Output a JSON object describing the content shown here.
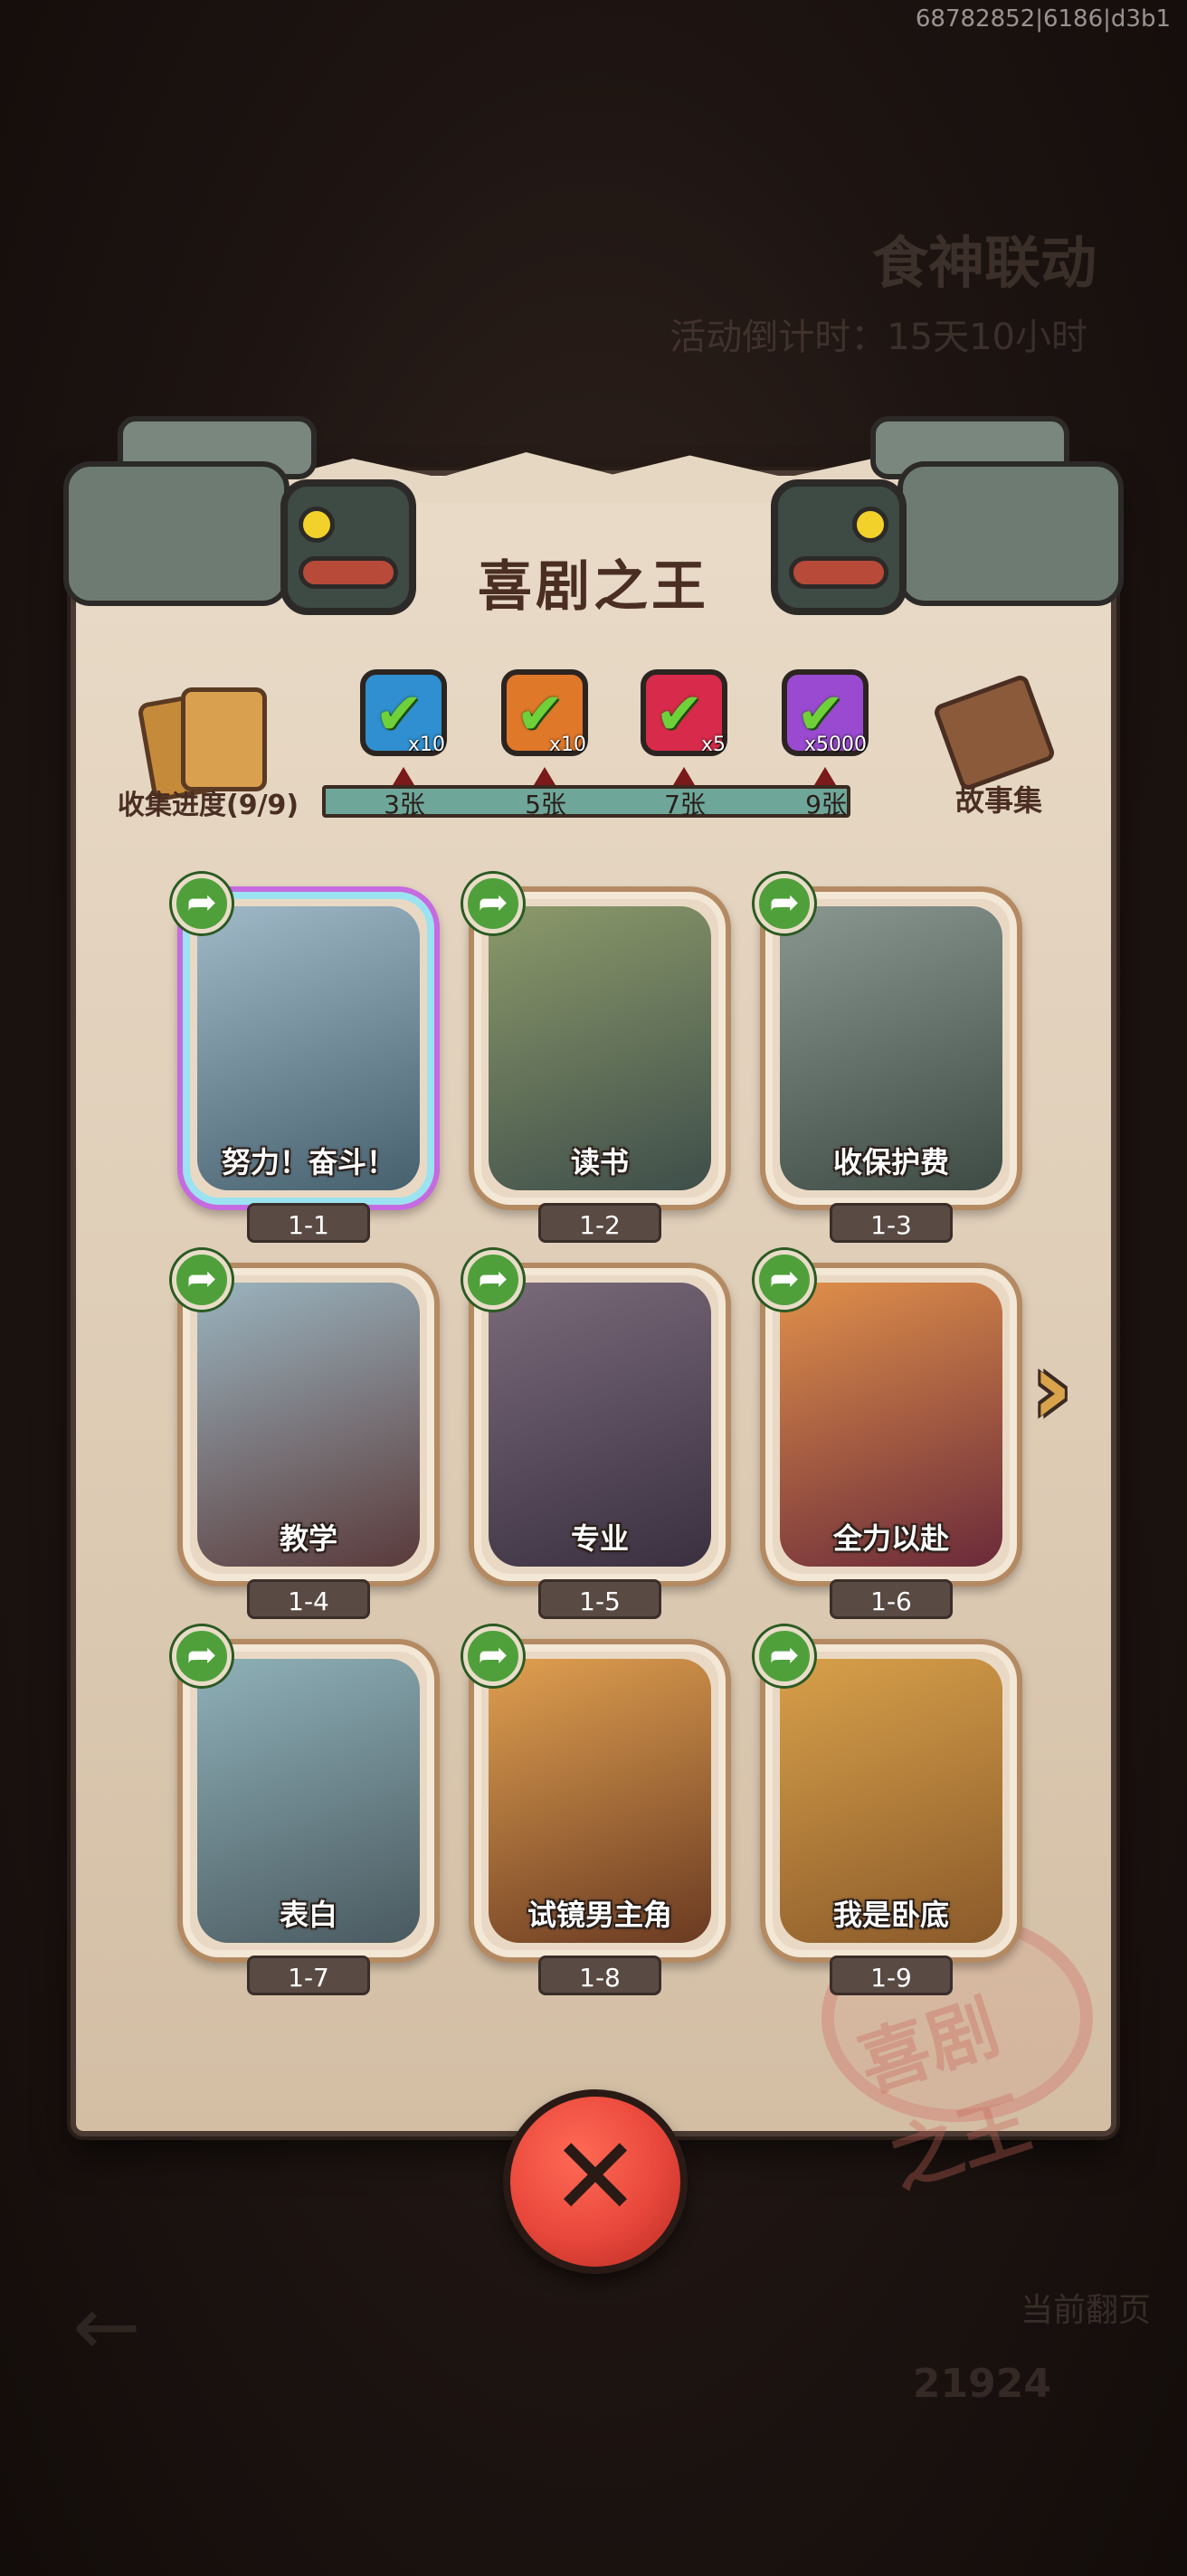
{
  "watermark": "68782852|6186|d3b1",
  "background": {
    "event_title": "食神联动",
    "countdown": "活动倒计时：15天10小时",
    "bottom_label": "当前翻页",
    "bottom_count": "21924"
  },
  "panel": {
    "title": "喜剧之王",
    "stamp_text": "喜剧之王",
    "collect_label": "收集进度(9/9)",
    "story_label": "故事集",
    "rewards": [
      {
        "qty": "x10",
        "color": "#2f8fd0",
        "icon": "blue-item-icon",
        "milestone": "3张"
      },
      {
        "qty": "x10",
        "color": "#e0782a",
        "icon": "orange-item-icon",
        "milestone": "5张"
      },
      {
        "qty": "x5",
        "color": "#d82a4a",
        "icon": "gem-icon",
        "milestone": "7张"
      },
      {
        "qty": "x5000",
        "color": "#9a4ad0",
        "icon": "coin-icon",
        "milestone": "9张"
      }
    ]
  },
  "cards": [
    {
      "caption": "努力！奋斗！",
      "num": "1-1",
      "art_colors": [
        "#9fb9c8",
        "#46606e"
      ]
    },
    {
      "caption": "读书",
      "num": "1-2",
      "art_colors": [
        "#8c9a6a",
        "#3e4e4a"
      ]
    },
    {
      "caption": "收保护费",
      "num": "1-3",
      "art_colors": [
        "#8a9690",
        "#3e4a44"
      ]
    },
    {
      "caption": "教学",
      "num": "1-4",
      "art_colors": [
        "#9ab4bf",
        "#5a3a3a"
      ]
    },
    {
      "caption": "专业",
      "num": "1-5",
      "art_colors": [
        "#7a6a7a",
        "#3a3040"
      ]
    },
    {
      "caption": "全力以赴",
      "num": "1-6",
      "art_colors": [
        "#e0904a",
        "#6a2a3a"
      ]
    },
    {
      "caption": "表白",
      "num": "1-7",
      "art_colors": [
        "#8fb0b8",
        "#4a5a60"
      ]
    },
    {
      "caption": "试镜男主角",
      "num": "1-8",
      "art_colors": [
        "#e0a050",
        "#6a3a22"
      ]
    },
    {
      "caption": "我是卧底",
      "num": "1-9",
      "art_colors": [
        "#d8a04a",
        "#8a5a2a"
      ]
    }
  ]
}
